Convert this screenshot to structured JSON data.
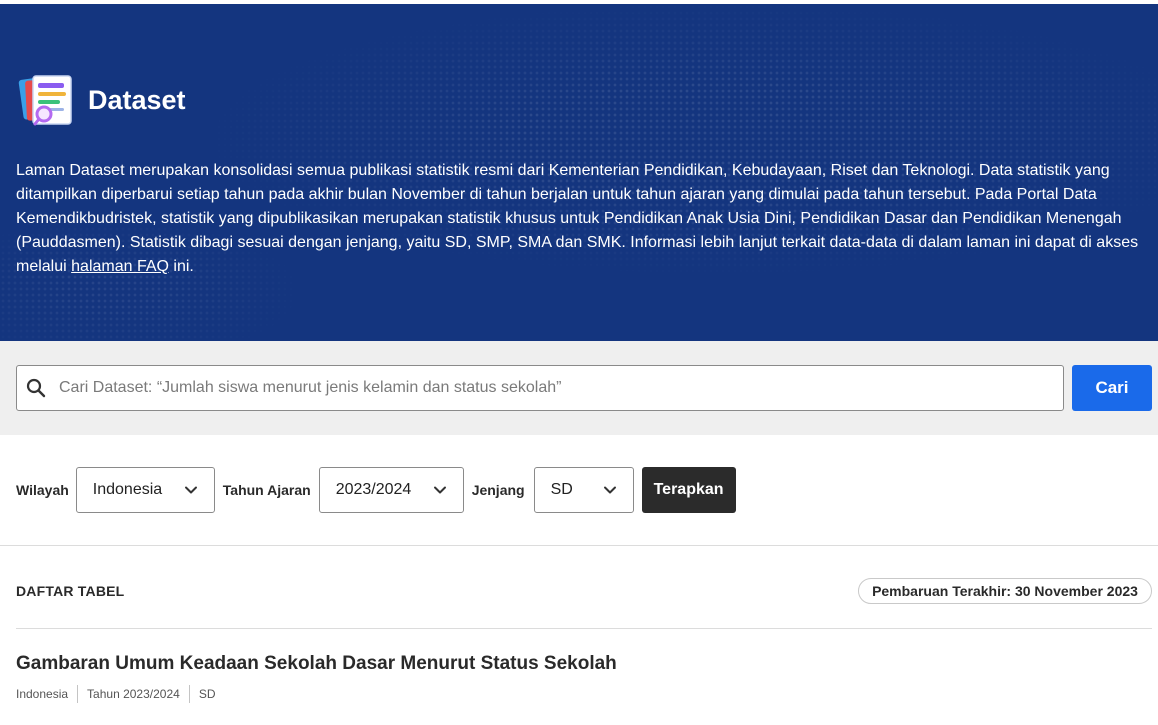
{
  "hero": {
    "title": "Dataset",
    "description_before_link": "Laman Dataset merupakan konsolidasi semua publikasi statistik resmi dari Kementerian Pendidikan, Kebudayaan, Riset dan Teknologi. Data statistik yang ditampilkan diperbarui setiap tahun pada akhir bulan November di tahun berjalan untuk tahun ajaran yang dimulai pada tahun tersebut. Pada Portal Data Kemendikbudristek, statistik yang dipublikasikan merupakan statistik khusus untuk Pendidikan Anak Usia Dini, Pendidikan Dasar dan Pendidikan Menengah (Pauddasmen). Statistik dibagi sesuai dengan jenjang, yaitu SD, SMP, SMA dan SMK. Informasi lebih lanjut terkait data-data di dalam laman ini dapat di akses melalui ",
    "faq_link": "halaman FAQ",
    "description_after_link": " ini.",
    "background_color": "#14357f"
  },
  "search": {
    "placeholder": "Cari Dataset: “Jumlah siswa menurut jenis kelamin dan status sekolah”",
    "value": "",
    "button_label": "Cari",
    "icon": "search-icon",
    "button_color": "#1a6aea"
  },
  "filters": {
    "wilayah_label": "Wilayah",
    "wilayah_value": "Indonesia",
    "tahun_label": "Tahun Ajaran",
    "tahun_value": "2023/2024",
    "jenjang_label": "Jenjang",
    "jenjang_value": "SD",
    "apply_label": "Terapkan",
    "icon": "chevron-down-icon"
  },
  "list": {
    "heading": "DAFTAR TABEL",
    "updated_badge": "Pembaruan Terakhir: 30 November 2023",
    "items": [
      {
        "title": "Gambaran Umum Keadaan Sekolah Dasar Menurut Status Sekolah",
        "meta": [
          "Indonesia",
          "Tahun 2023/2024",
          "SD"
        ]
      }
    ]
  }
}
